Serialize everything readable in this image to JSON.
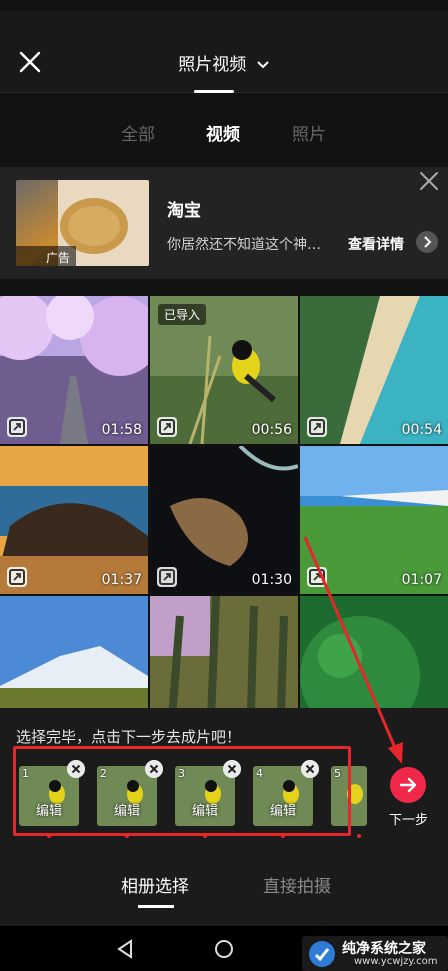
{
  "header": {
    "title": "照片视频"
  },
  "filters": [
    {
      "label": "全部"
    },
    {
      "label": "视频"
    },
    {
      "label": "照片"
    }
  ],
  "ad": {
    "badge": "广告",
    "title": "淘宝",
    "desc": "你居然还不知道这个神…",
    "more": "查看详情"
  },
  "media": [
    {
      "duration": "01:58"
    },
    {
      "duration": "00:56",
      "badge": "已导入"
    },
    {
      "duration": "00:54"
    },
    {
      "duration": "01:37"
    },
    {
      "duration": "01:30"
    },
    {
      "duration": "01:07"
    }
  ],
  "selection": {
    "hint": "选择完毕，点击下一步去成片吧！",
    "items": [
      {
        "num": "1",
        "edit": "编辑"
      },
      {
        "num": "2",
        "edit": "编辑"
      },
      {
        "num": "3",
        "edit": "编辑"
      },
      {
        "num": "4",
        "edit": "编辑"
      },
      {
        "num": "5"
      }
    ],
    "next_label": "下一步"
  },
  "tabs": [
    {
      "label": "相册选择"
    },
    {
      "label": "直接拍摄"
    }
  ],
  "watermark": {
    "title": "纯净系统之家",
    "url": "www.ycwjzy.com"
  },
  "colors": {
    "accent": "#f0294a",
    "highlight": "#e5262a"
  }
}
